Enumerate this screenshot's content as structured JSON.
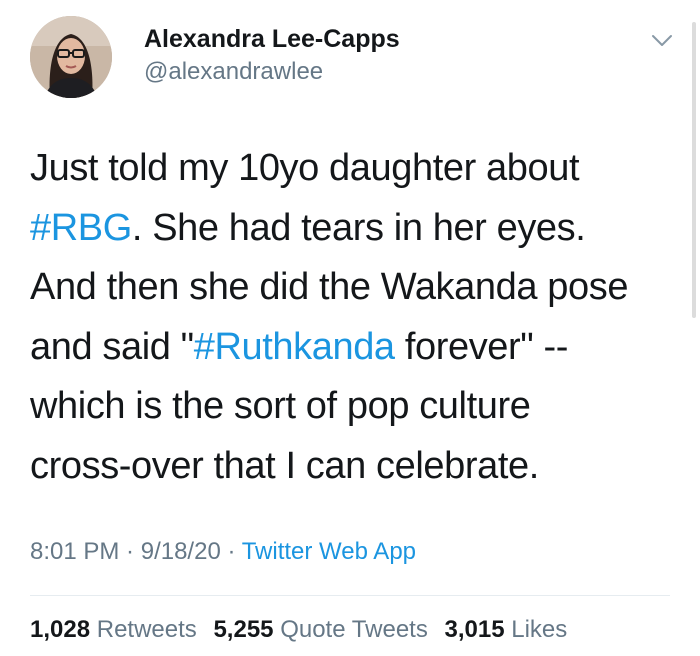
{
  "author": {
    "display_name": "Alexandra Lee-Capps",
    "handle": "@alexandrawlee"
  },
  "tweet": {
    "lines": [
      [
        {
          "text": "Just told my 10yo daughter about",
          "link": false
        }
      ],
      [
        {
          "text": "#RBG",
          "link": true
        },
        {
          "text": ". She had tears in her eyes.",
          "link": false
        }
      ],
      [
        {
          "text": "And then she did the Wakanda pose",
          "link": false
        }
      ],
      [
        {
          "text": "and said \"",
          "link": false
        },
        {
          "text": "#Ruthkanda",
          "link": true
        },
        {
          "text": " forever\" --",
          "link": false
        }
      ],
      [
        {
          "text": "which is the sort of pop culture",
          "link": false
        }
      ],
      [
        {
          "text": "cross-over that I can celebrate.",
          "link": false
        }
      ]
    ]
  },
  "meta": {
    "time": "8:01 PM",
    "sep1": " · ",
    "date": "9/18/20",
    "sep2": " · ",
    "source": "Twitter Web App"
  },
  "stats": {
    "retweets_count": "1,028",
    "retweets_label": "Retweets",
    "quotes_count": "5,255",
    "quotes_label": "Quote Tweets",
    "likes_count": "3,015",
    "likes_label": "Likes"
  },
  "colors": {
    "link": "#1b95e0",
    "secondary_text": "#657786",
    "primary_text": "#14171a"
  },
  "icons": {
    "menu": "chevron-down-icon"
  }
}
